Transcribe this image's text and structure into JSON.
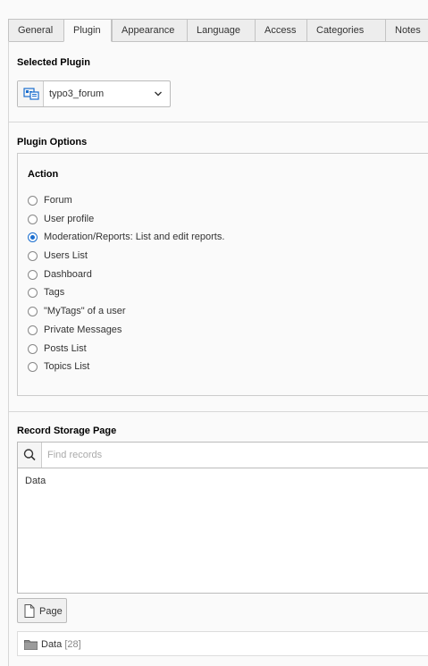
{
  "tabs": [
    {
      "label": "General",
      "active": false
    },
    {
      "label": "Plugin",
      "active": true
    },
    {
      "label": "Appearance",
      "active": false
    },
    {
      "label": "Language",
      "active": false
    },
    {
      "label": "Access",
      "active": false
    },
    {
      "label": "Categories",
      "active": false
    },
    {
      "label": "Notes",
      "active": false
    }
  ],
  "selected_plugin": {
    "title": "Selected Plugin",
    "icon": "plugin-icon",
    "value": "typo3_forum"
  },
  "plugin_options": {
    "title": "Plugin Options",
    "action_label": "Action",
    "options": [
      {
        "label": "Forum",
        "checked": false
      },
      {
        "label": "User profile",
        "checked": false
      },
      {
        "label": "Moderation/Reports: List and edit reports.",
        "checked": true
      },
      {
        "label": "Users List",
        "checked": false
      },
      {
        "label": "Dashboard",
        "checked": false
      },
      {
        "label": "Tags",
        "checked": false
      },
      {
        "label": "\"MyTags\" of a user",
        "checked": false
      },
      {
        "label": "Private Messages",
        "checked": false
      },
      {
        "label": "Posts List",
        "checked": false
      },
      {
        "label": "Topics List",
        "checked": false
      }
    ]
  },
  "record_storage": {
    "title": "Record Storage Page",
    "search_placeholder": "Find records",
    "items": [
      "Data"
    ],
    "page_button_label": "Page",
    "footer_label": "Data",
    "footer_count": "[28]"
  },
  "colors": {
    "accent": "#1a6ecf",
    "border": "#c3c3c3",
    "background": "#fafafa"
  }
}
